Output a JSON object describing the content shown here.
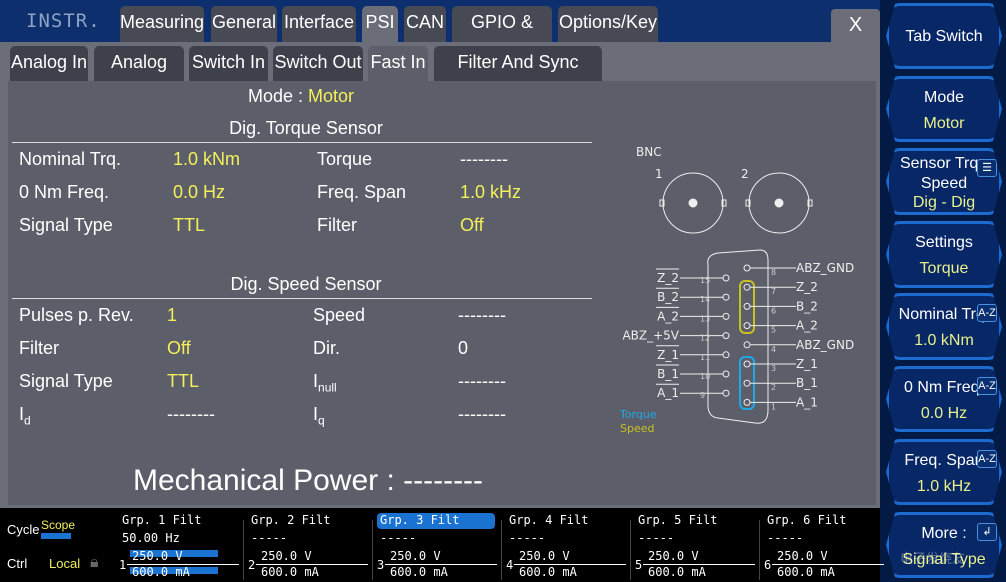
{
  "header": {
    "instrument": "INSTR.",
    "tabs": [
      "Measuring",
      "General",
      "Interface",
      "PSI",
      "CAN",
      "GPIO & Sync",
      "Options/Key"
    ],
    "active_tab": "PSI",
    "close": "X"
  },
  "subtabs": {
    "items": [
      "Analog In",
      "Analog Out",
      "Switch In",
      "Switch Out",
      "Fast In",
      "Filter And Sync Group"
    ],
    "active": "Fast In"
  },
  "mode": {
    "label": "Mode :",
    "value": "Motor"
  },
  "torque_sensor": {
    "title": "Dig. Torque Sensor",
    "rows": [
      [
        "Nominal Trq.",
        "1.0 kNm",
        "Torque",
        "--------"
      ],
      [
        "0 Nm Freq.",
        "0.0 Hz",
        "Freq. Span",
        "1.0 kHz"
      ],
      [
        "Signal Type",
        "TTL",
        "Filter",
        "Off"
      ]
    ]
  },
  "speed_sensor": {
    "title": "Dig. Speed Sensor",
    "rows": [
      [
        "Pulses p. Rev.",
        "1",
        "Speed",
        "--------"
      ],
      [
        "Filter",
        "Off",
        "Dir.",
        "0"
      ],
      [
        "Signal Type",
        "TTL",
        "I",
        "--------"
      ],
      [
        "I",
        "--------",
        "I",
        "--------"
      ]
    ],
    "subs": {
      "inull": "null",
      "id": "d",
      "iq": "q"
    }
  },
  "mechanical_power": "Mechanical Power : --------",
  "diagram": {
    "bnc": "BNC",
    "bnc1": "1",
    "bnc2": "2",
    "left_pins": [
      {
        "n": "15",
        "l": "Z_2"
      },
      {
        "n": "14",
        "l": "B_2"
      },
      {
        "n": "13",
        "l": "A_2"
      },
      {
        "n": "12",
        "l": "ABZ_+5V"
      },
      {
        "n": "11",
        "l": "Z_1"
      },
      {
        "n": "10",
        "l": "B_1"
      },
      {
        "n": "9",
        "l": "A_1"
      }
    ],
    "right_pins": [
      {
        "n": "8",
        "l": "ABZ_GND"
      },
      {
        "n": "7",
        "l": "Z_2"
      },
      {
        "n": "6",
        "l": "B_2"
      },
      {
        "n": "5",
        "l": "A_2"
      },
      {
        "n": "4",
        "l": "ABZ_GND"
      },
      {
        "n": "3",
        "l": "Z_1"
      },
      {
        "n": "2",
        "l": "B_1"
      },
      {
        "n": "1",
        "l": "A_1"
      }
    ],
    "legend_torque": "Torque",
    "legend_speed": "Speed",
    "torque_color": "#1ea8e8",
    "speed_color": "#c8c020"
  },
  "sidebar": [
    {
      "l1": "Tab Switch",
      "l2": ""
    },
    {
      "l1": "Mode",
      "l2": "Motor"
    },
    {
      "l1": "Sensor Trq - Speed",
      "l2": "Dig - Dig",
      "badge": "list-icon"
    },
    {
      "l1": "Settings",
      "l2": "Torque"
    },
    {
      "l1": "Nominal Trq.",
      "l2": "1.0 kNm",
      "badge": "A-Z"
    },
    {
      "l1": "0 Nm Freq.",
      "l2": "0.0 Hz",
      "badge": "A-Z"
    },
    {
      "l1": "Freq. Span",
      "l2": "1.0 kHz",
      "badge": "A-Z"
    },
    {
      "l1": "More :",
      "l2": "Signal Type",
      "badge": "↲"
    }
  ],
  "status": {
    "cycle": "Cycle",
    "cycle_mode": "Scope",
    "ctrl": "Ctrl",
    "ctrl_mode": "Local"
  },
  "groups": [
    {
      "t": "Grp. 1 Filt",
      "v": "50.00  Hz",
      "n": "1",
      "u": "250.0 V",
      "i": "600.0 mA"
    },
    {
      "t": "Grp. 2 Filt",
      "v": "-----",
      "n": "2",
      "u": "250.0 V",
      "i": "600.0 mA"
    },
    {
      "t": "Grp. 3 Filt",
      "v": "-----",
      "n": "3",
      "u": "250.0 V",
      "i": "600.0 mA",
      "selected": true
    },
    {
      "t": "Grp. 4 Filt",
      "v": "-----",
      "n": "4",
      "u": "250.0 V",
      "i": "600.0 mA"
    },
    {
      "t": "Grp. 5 Filt",
      "v": "-----",
      "n": "5",
      "u": "250.0 V",
      "i": "600.0 mA"
    },
    {
      "t": "Grp. 6 Filt",
      "v": "-----",
      "n": "6",
      "u": "250.0 V",
      "i": "600.0 mA"
    }
  ],
  "watermark": "电子发烧友 www.elecfans.com"
}
